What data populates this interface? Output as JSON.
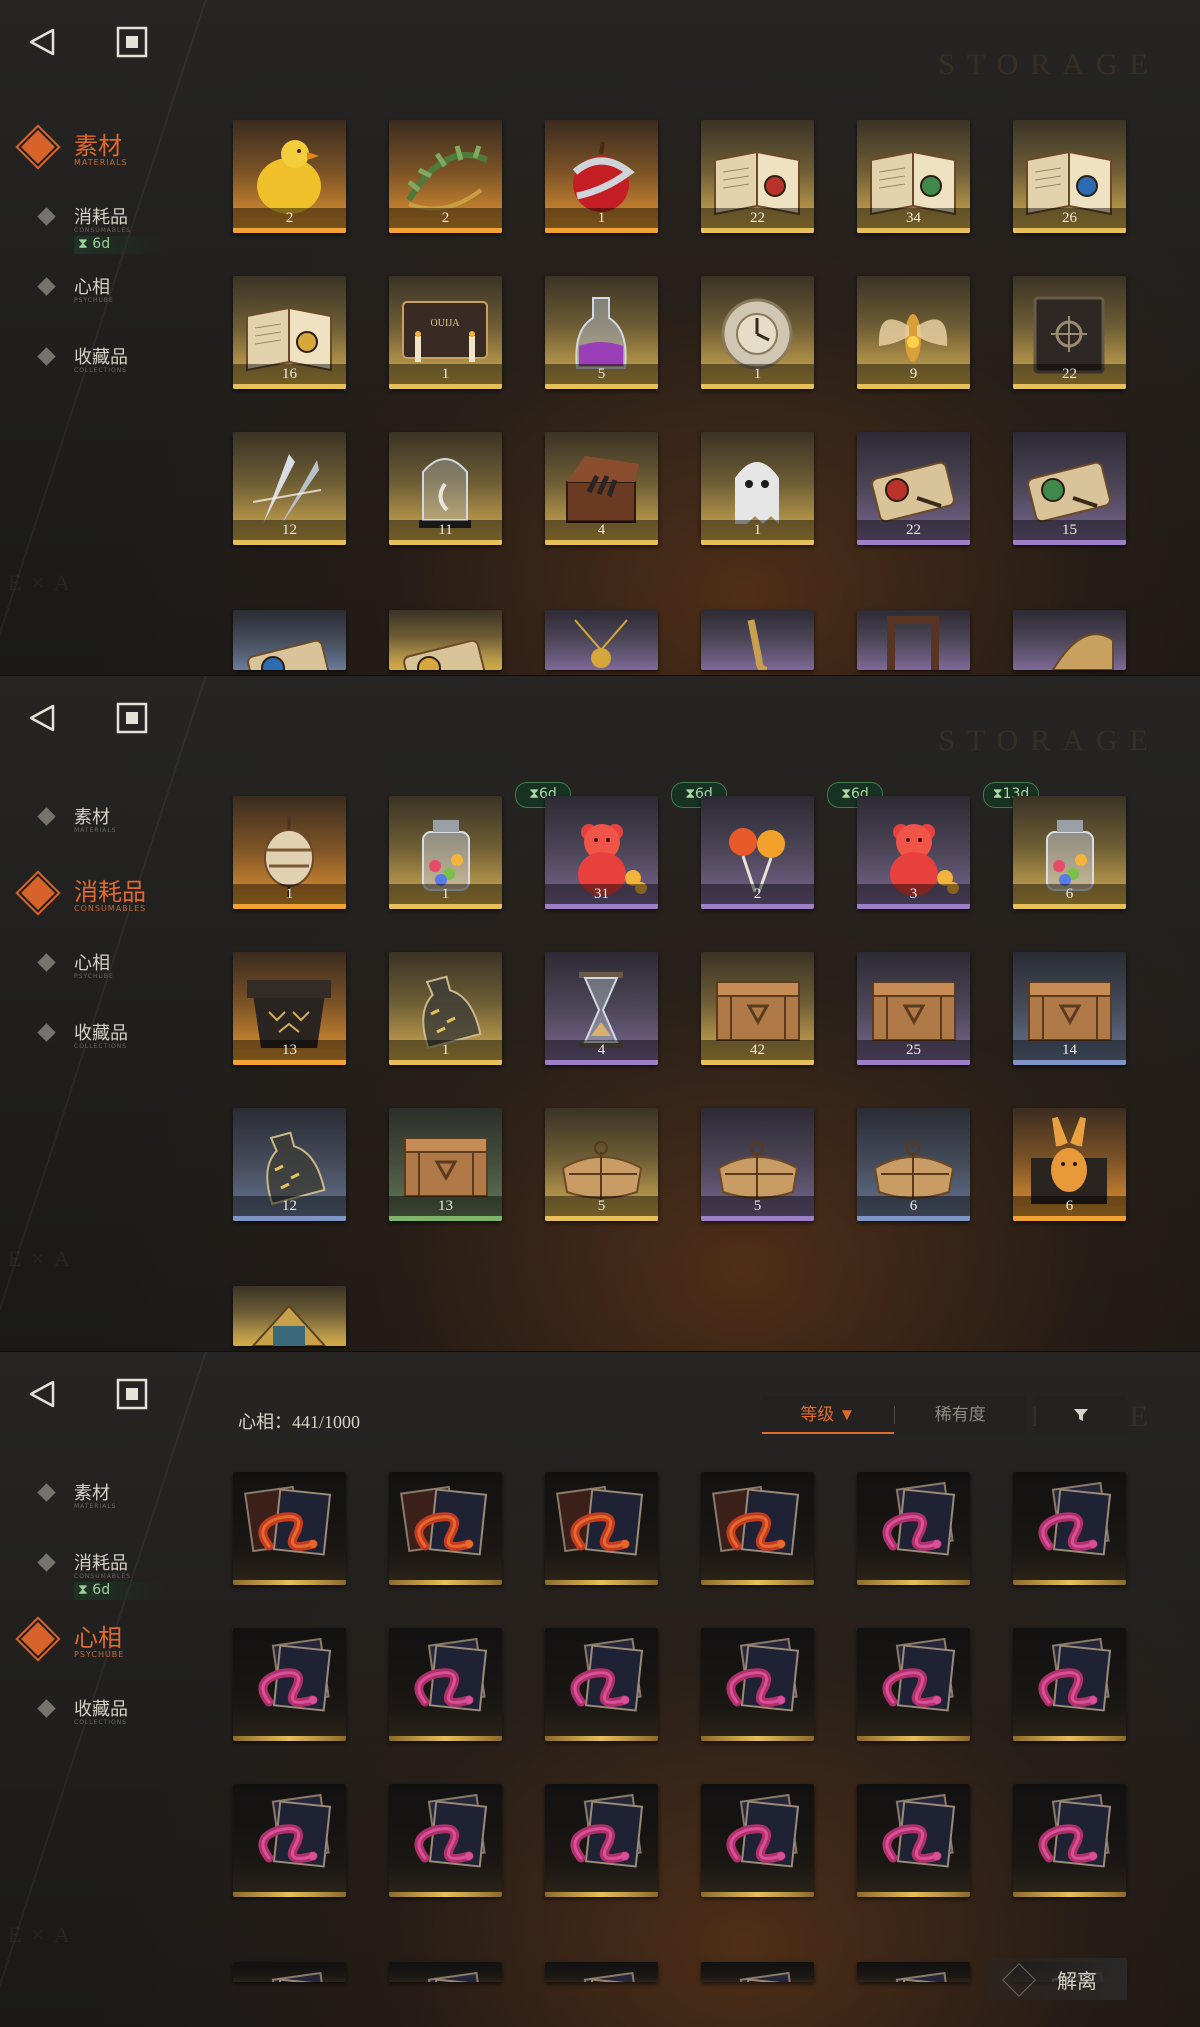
{
  "watermark": "STORAGE",
  "panels": [
    {
      "active": 0,
      "nav": [
        {
          "label": "素材",
          "sub": "MATERIALS",
          "timer": ""
        },
        {
          "label": "消耗品",
          "sub": "CONSUMABLES",
          "timer": "6d"
        },
        {
          "label": "心相",
          "sub": "PSYCHUBE",
          "timer": ""
        },
        {
          "label": "收藏品",
          "sub": "COLLECTIONS",
          "timer": ""
        }
      ],
      "tiles": [
        {
          "icon": "chicken-icon",
          "rarity": "orange",
          "count": "2"
        },
        {
          "icon": "herb-wreath-icon",
          "rarity": "orange",
          "count": "2"
        },
        {
          "icon": "apple-snake-icon",
          "rarity": "orange",
          "count": "1"
        },
        {
          "icon": "red-book-icon",
          "rarity": "gold",
          "count": "22"
        },
        {
          "icon": "green-book-icon",
          "rarity": "gold",
          "count": "34"
        },
        {
          "icon": "blue-book-icon",
          "rarity": "gold",
          "count": "26"
        },
        {
          "icon": "gold-book-icon",
          "rarity": "gold",
          "count": "16"
        },
        {
          "icon": "ouija-board-icon",
          "rarity": "gold",
          "count": "1"
        },
        {
          "icon": "potion-bottle-icon",
          "rarity": "gold",
          "count": "5"
        },
        {
          "icon": "clock-device-icon",
          "rarity": "gold",
          "count": "1"
        },
        {
          "icon": "moth-icon",
          "rarity": "gold",
          "count": "9"
        },
        {
          "icon": "dark-tome-icon",
          "rarity": "gold",
          "count": "22"
        },
        {
          "icon": "silver-spikes-icon",
          "rarity": "gold",
          "count": "12"
        },
        {
          "icon": "bell-jar-icon",
          "rarity": "gold",
          "count": "11"
        },
        {
          "icon": "hand-box-icon",
          "rarity": "gold",
          "count": "4"
        },
        {
          "icon": "ghost-icon",
          "rarity": "gold",
          "count": "1"
        },
        {
          "icon": "red-scroll-icon",
          "rarity": "purple",
          "count": "22"
        },
        {
          "icon": "green-scroll-icon",
          "rarity": "purple",
          "count": "15"
        },
        {
          "icon": "blue-scroll-icon",
          "rarity": "blue",
          "count": ""
        },
        {
          "icon": "gold-scroll-icon",
          "rarity": "gold",
          "count": ""
        },
        {
          "icon": "amulet-icon",
          "rarity": "purple",
          "count": ""
        },
        {
          "icon": "saxophone-icon",
          "rarity": "purple",
          "count": ""
        },
        {
          "icon": "frame-icon",
          "rarity": "purple",
          "count": ""
        },
        {
          "icon": "iron-icon",
          "rarity": "purple",
          "count": ""
        }
      ]
    },
    {
      "active": 1,
      "nav": [
        {
          "label": "素材",
          "sub": "MATERIALS",
          "timer": ""
        },
        {
          "label": "消耗品",
          "sub": "CONSUMABLES",
          "timer": ""
        },
        {
          "label": "心相",
          "sub": "PSYCHUBE",
          "timer": ""
        },
        {
          "label": "收藏品",
          "sub": "COLLECTIONS",
          "timer": ""
        }
      ],
      "tiles": [
        {
          "icon": "charm-pouch-icon",
          "rarity": "orange",
          "count": "1",
          "badge": ""
        },
        {
          "icon": "candy-jar-icon",
          "rarity": "gold",
          "count": "1",
          "badge": "6d"
        },
        {
          "icon": "gummy-bear-icon",
          "rarity": "purple",
          "count": "31",
          "badge": "6d"
        },
        {
          "icon": "lollipop-icon",
          "rarity": "purple",
          "count": "2",
          "badge": "6d"
        },
        {
          "icon": "gummy-bear-icon",
          "rarity": "purple",
          "count": "3",
          "badge": "13d"
        },
        {
          "icon": "candy-jar-icon",
          "rarity": "gold",
          "count": "6",
          "badge": ""
        },
        {
          "icon": "rune-chest-icon",
          "rarity": "orange",
          "count": "13",
          "badge": ""
        },
        {
          "icon": "message-bottle-icon",
          "rarity": "gold",
          "count": "1",
          "badge": ""
        },
        {
          "icon": "hourglass-icon",
          "rarity": "purple",
          "count": "4",
          "badge": ""
        },
        {
          "icon": "wooden-crate-icon",
          "rarity": "gold",
          "count": "42",
          "badge": ""
        },
        {
          "icon": "wooden-crate-icon",
          "rarity": "purple",
          "count": "25",
          "badge": ""
        },
        {
          "icon": "wooden-crate-icon",
          "rarity": "blue",
          "count": "14",
          "badge": ""
        },
        {
          "icon": "message-bottle-icon",
          "rarity": "blue",
          "count": "12",
          "badge": ""
        },
        {
          "icon": "wooden-crate-icon",
          "rarity": "green",
          "count": "13",
          "badge": ""
        },
        {
          "icon": "parcel-icon",
          "rarity": "gold",
          "count": "5",
          "badge": ""
        },
        {
          "icon": "parcel-icon",
          "rarity": "purple",
          "count": "5",
          "badge": ""
        },
        {
          "icon": "parcel-icon",
          "rarity": "blue",
          "count": "6",
          "badge": ""
        },
        {
          "icon": "golden-rabbit-icon",
          "rarity": "orange",
          "count": "6",
          "badge": ""
        },
        {
          "icon": "gold-box-icon",
          "rarity": "gold",
          "count": "",
          "badge": ""
        }
      ]
    },
    {
      "active": 2,
      "nav": [
        {
          "label": "素材",
          "sub": "MATERIALS",
          "timer": ""
        },
        {
          "label": "消耗品",
          "sub": "CONSUMABLES",
          "timer": "6d"
        },
        {
          "label": "心相",
          "sub": "PSYCHUBE",
          "timer": ""
        },
        {
          "label": "收藏品",
          "sub": "COLLECTIONS",
          "timer": ""
        }
      ],
      "psychube": {
        "count_label": "心相：",
        "count_value": "441/1000",
        "sort_level": "等级 ▼",
        "sort_rarity": "稀有度",
        "release": "解离"
      },
      "cards": [
        "red",
        "red",
        "red",
        "red",
        "pink",
        "pink",
        "pink",
        "pink",
        "pink",
        "pink",
        "pink",
        "pink",
        "pink",
        "pink",
        "pink",
        "pink",
        "pink",
        "pink",
        "pink",
        "pink",
        "pink",
        "pink",
        "pink",
        "pink"
      ]
    }
  ],
  "colors": {
    "accent": "#e0692e",
    "timer": "#9cd19a",
    "gold": "#e6c05a",
    "purple": "#9c7fc6"
  }
}
